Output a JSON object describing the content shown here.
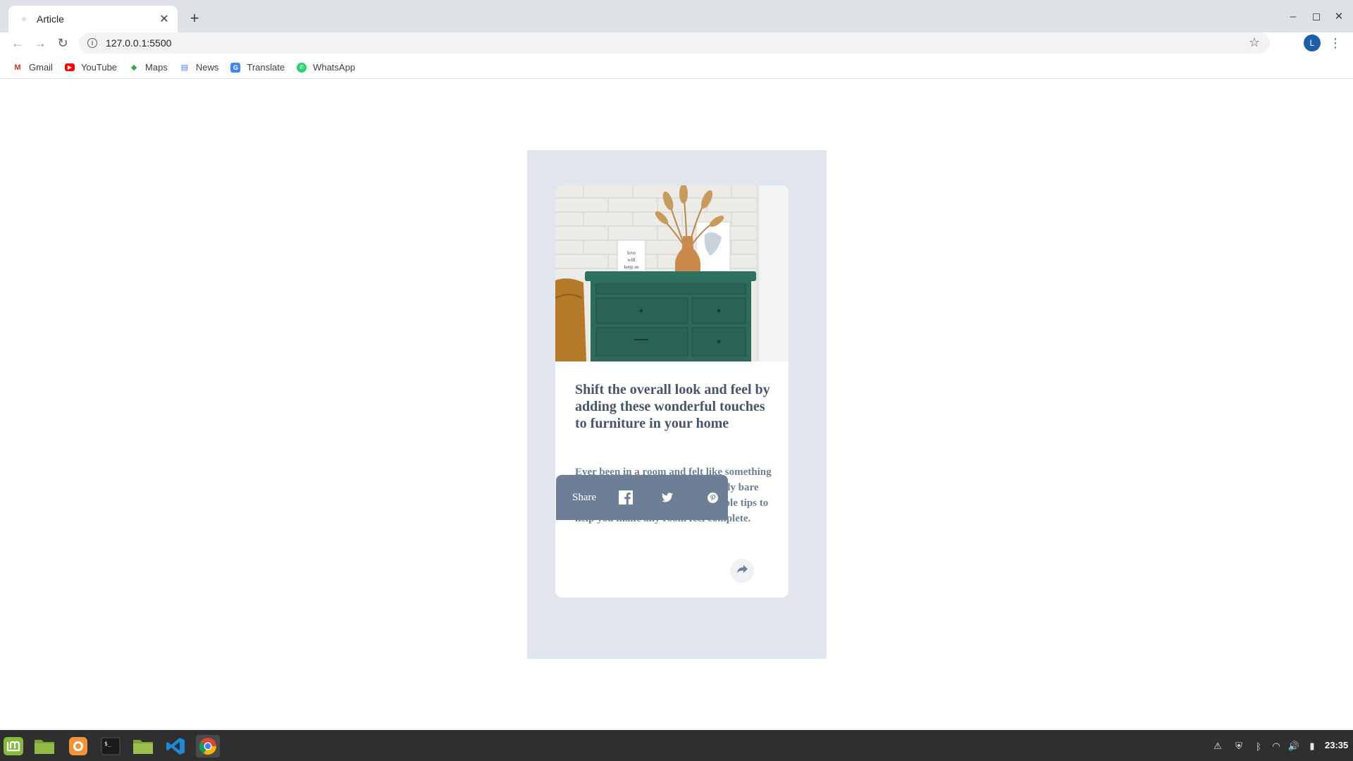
{
  "browser": {
    "tab_title": "Article",
    "tab_close": "✕",
    "new_tab": "+",
    "url": "127.0.0.1:5500",
    "profile_initial": "L",
    "bookmarks": [
      {
        "label": "Gmail",
        "icon": "gmail-icon",
        "color": "#d93025"
      },
      {
        "label": "YouTube",
        "icon": "youtube-icon",
        "color": "#ff0000"
      },
      {
        "label": "Maps",
        "icon": "maps-icon",
        "color": "#34a853"
      },
      {
        "label": "News",
        "icon": "news-icon",
        "color": "#4285f4"
      },
      {
        "label": "Translate",
        "icon": "translate-icon",
        "color": "#4285f4"
      },
      {
        "label": "WhatsApp",
        "icon": "whatsapp-icon",
        "color": "#25d366"
      }
    ]
  },
  "article": {
    "title": "Shift the overall look and feel by adding these wonderful touches to furniture in your home",
    "summary": "Ever been in a room and felt like something was missing? Perhaps it felt slightly bare and uninviting. I've got some simple tips to help you make any room feel complete.",
    "image_alt": "drawers"
  },
  "share": {
    "label": "Share",
    "icons": [
      "facebook-icon",
      "twitter-icon",
      "pinterest-icon",
      "share-icon"
    ]
  },
  "colors": {
    "stage_bg": "#e1e6ee",
    "heading": "#48556a",
    "body": "#6d7f97",
    "share_panel": "#6d7f97",
    "cabinet": "#2d6a5c"
  },
  "taskbar": {
    "apps": [
      "mint-menu-icon",
      "files-green-icon",
      "firefox-icon",
      "terminal-icon",
      "folder-icon",
      "vscode-icon",
      "chrome-icon"
    ],
    "clock": "23:35"
  }
}
